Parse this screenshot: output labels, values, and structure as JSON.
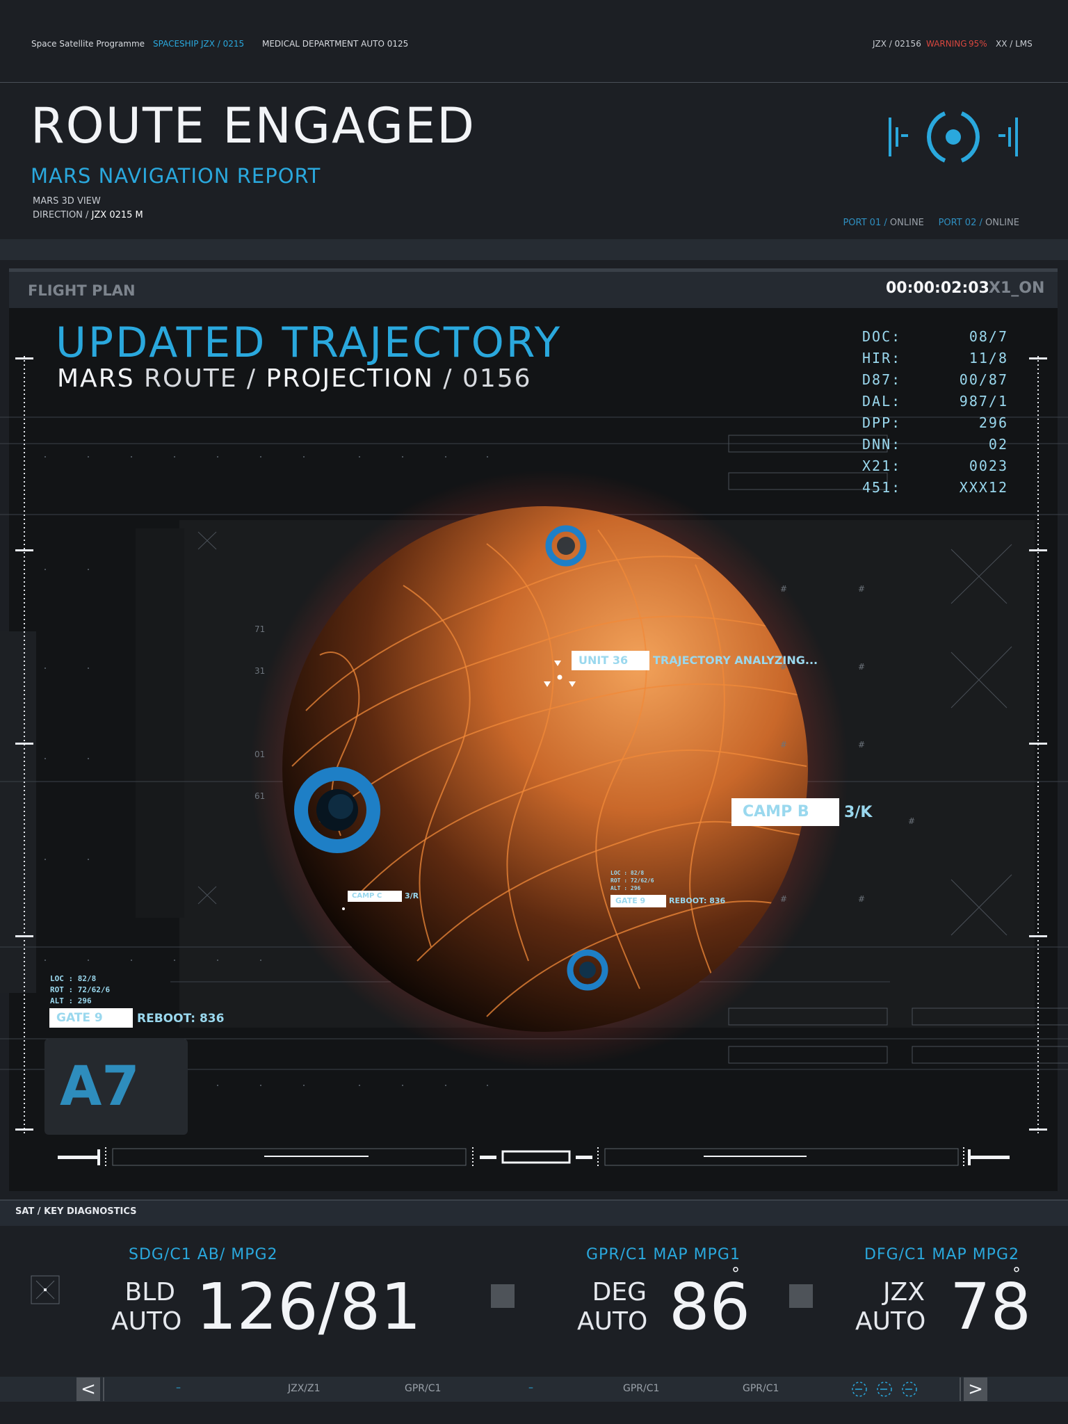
{
  "top_bar": {
    "program": "Space Satellite Programme",
    "spaceship_label": "SPACESHIP",
    "spaceship_id": "JZX / 0215",
    "department": "MEDICAL DEPARTMENT AUTO 0125",
    "right_id": "JZX / 02156",
    "warning_label": "WARNING",
    "warning_pct": "95%",
    "right_tail": "XX / LMS"
  },
  "header": {
    "title": "ROUTE ENGAGED",
    "subtitle": "MARS NAVIGATION REPORT",
    "view_label": "MARS 3D VIEW",
    "direction_label": "DIRECTION /",
    "direction_value": "JZX 0215  M",
    "port1": "PORT 01",
    "port1_status": "ONLINE",
    "port2": "PORT 02",
    "port2_status": "ONLINE",
    "slash": "/"
  },
  "flight_plan": {
    "title": "FLIGHT PLAN",
    "timer": "00:00:02:03",
    "mode": "X1_ON",
    "traj_title": "UPDATED TRAJECTORY",
    "traj_sub_a": "MARS",
    "traj_sub_b": "ROUTE /",
    "traj_sub_c": "PROJECTION",
    "traj_sub_d": "/ 0156",
    "stats": [
      {
        "k": "DOC:",
        "v": "08/7"
      },
      {
        "k": "HIR:",
        "v": "11/8"
      },
      {
        "k": "D87:",
        "v": "00/87"
      },
      {
        "k": "DAL:",
        "v": "987/1"
      },
      {
        "k": "DPP:",
        "v": "296"
      },
      {
        "k": "DNN:",
        "v": "02"
      },
      {
        "k": "X21:",
        "v": "0023"
      },
      {
        "k": "451:",
        "v": "XXX12"
      }
    ],
    "ticks": [
      "71",
      "31",
      "01",
      "61"
    ],
    "unit_tag": "UNIT 36",
    "unit_text": "TRAJECTORY ANALYZING...",
    "camp_b": "CAMP B",
    "camp_b_code": "3/K",
    "camp_c": "CAMP C",
    "camp_c_code": "3/R",
    "mini_loc": "LOC   : 82/8",
    "mini_rot": "ROT   : 72/62/6",
    "mini_alt": "ALT   : 296",
    "gate_small": "GATE 9",
    "reboot_small": "REBOOT: 836",
    "big_loc": "LOC   : 82/8",
    "big_rot": "ROT   : 72/62/6",
    "big_alt": "ALT   : 296",
    "gate_big": "GATE 9",
    "reboot_big": "REBOOT: 836",
    "a7": "A7",
    "hash": "#"
  },
  "diagnostics": {
    "title": "SAT / KEY DIAGNOSTICS",
    "m1_label": "SDG/C1   AB/  MPG2",
    "m1_side1": "BLD",
    "m1_side2": "AUTO",
    "m1_value": "126/81",
    "m2_label": "GPR/C1   MAP   MPG1",
    "m2_side1": "DEG",
    "m2_side2": "AUTO",
    "m2_value": "86",
    "m3_label": "DFG/C1   MAP   MPG2",
    "m3_side1": "JZX",
    "m3_side2": "AUTO",
    "m3_value": "78",
    "degree": "°"
  },
  "footer": {
    "prev": "<",
    "next": ">",
    "dash1": "–",
    "item1": "JZX/Z1",
    "item2": "GPR/C1",
    "dash2": "–",
    "item3": "GPR/C1",
    "item4": "GPR/C1"
  },
  "colors": {
    "accent": "#2aa8dd",
    "warning": "#d9473f",
    "background": "#1c1f24",
    "mars": "#e07a2e"
  }
}
